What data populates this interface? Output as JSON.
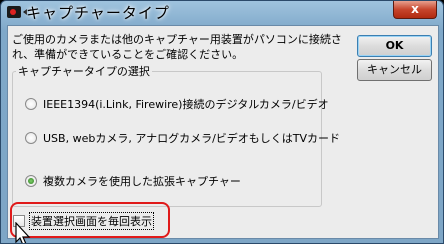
{
  "window": {
    "title": "キャプチャータイプ",
    "close_glyph": "x"
  },
  "description": "ご使用のカメラまたは他のキャプチャー用装置がパソコンに接続され、準備ができていることをご確認ください。",
  "buttons": {
    "ok_label": "OK",
    "cancel_label": "キャンセル"
  },
  "group": {
    "title": "キャプチャータイプの選択",
    "options": [
      {
        "label": "IEEE1394(i.Link, Firewire)接続のデジタルカメラ/ビデオ",
        "checked": false
      },
      {
        "label": "USB, webカメラ, アナログカメラ/ビデオもしくはTVカード",
        "checked": false
      },
      {
        "label": "複数カメラを使用した拡張キャプチャー",
        "checked": true
      }
    ]
  },
  "checkbox": {
    "label": "装置選択画面を毎回表示",
    "checked": false
  },
  "colors": {
    "highlight": "#e01a1a",
    "title_bar": "#7fa8c9"
  }
}
